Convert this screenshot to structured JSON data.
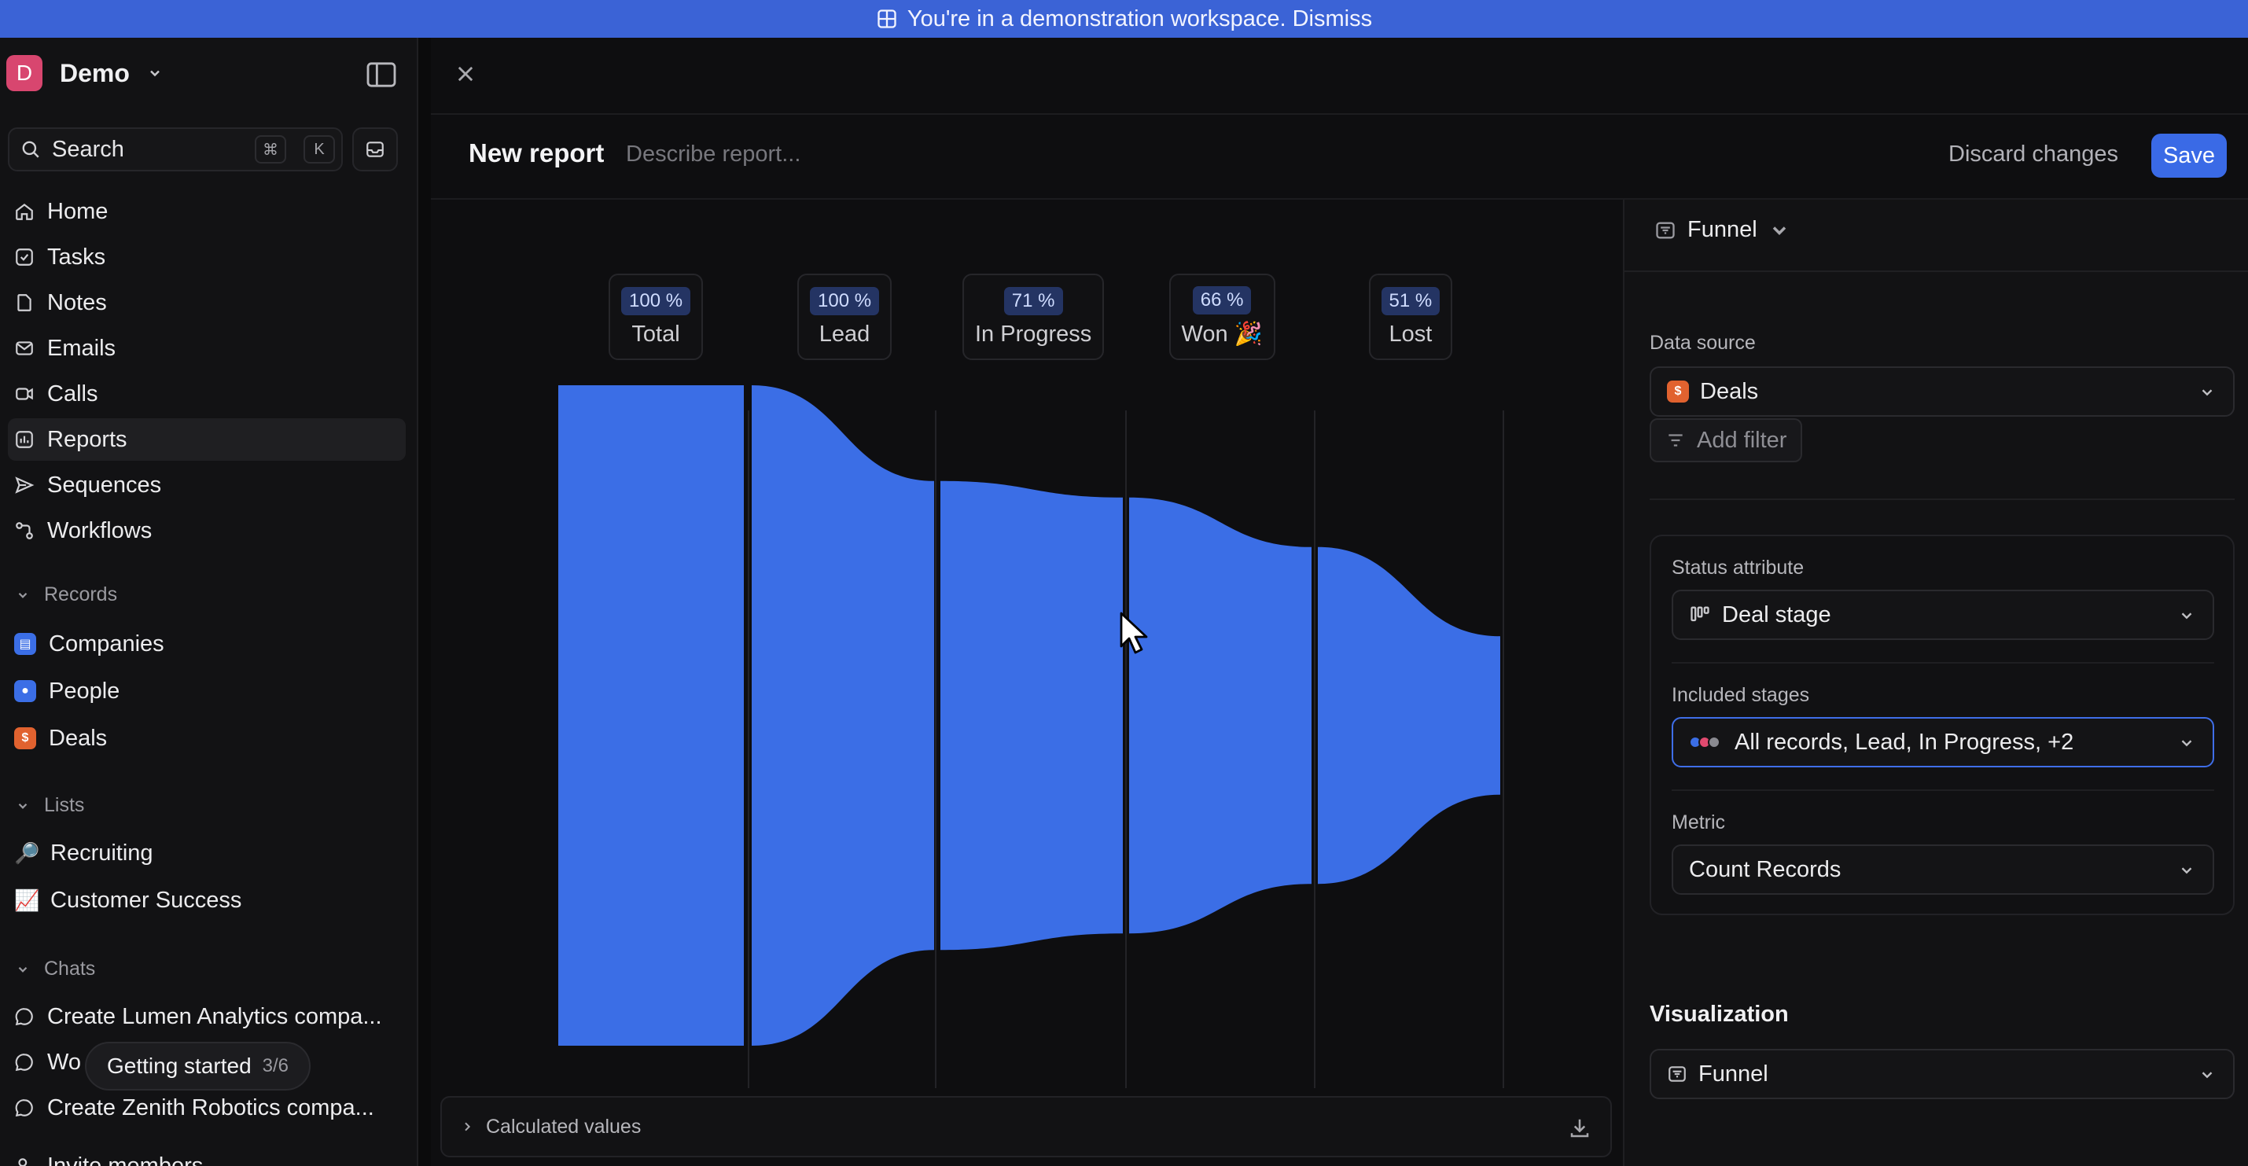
{
  "banner": {
    "text": "You're in a demonstration workspace. Dismiss"
  },
  "workspace": {
    "initial": "D",
    "name": "Demo"
  },
  "search": {
    "label": "Search",
    "key1": "⌘",
    "key2": "K"
  },
  "nav": [
    {
      "label": "Home",
      "icon": "home-icon"
    },
    {
      "label": "Tasks",
      "icon": "tasks-icon"
    },
    {
      "label": "Notes",
      "icon": "notes-icon"
    },
    {
      "label": "Emails",
      "icon": "emails-icon"
    },
    {
      "label": "Calls",
      "icon": "calls-icon"
    },
    {
      "label": "Reports",
      "icon": "reports-icon",
      "active": true
    },
    {
      "label": "Sequences",
      "icon": "sequences-icon"
    },
    {
      "label": "Workflows",
      "icon": "workflows-icon"
    }
  ],
  "records": {
    "header": "Records",
    "items": [
      {
        "label": "Companies",
        "color": "#3b6ee6",
        "glyph": "▤"
      },
      {
        "label": "People",
        "color": "#3b6ee6",
        "glyph": "●"
      },
      {
        "label": "Deals",
        "color": "#e1622f",
        "glyph": "$"
      }
    ]
  },
  "lists": {
    "header": "Lists",
    "items": [
      {
        "label": "Recruiting",
        "emoji": "🔎"
      },
      {
        "label": "Customer Success",
        "emoji": "📈"
      }
    ]
  },
  "chats": {
    "header": "Chats",
    "items": [
      {
        "label": "Create Lumen Analytics compa..."
      },
      {
        "label": "Wo                    ropo..."
      },
      {
        "label": "Create Zenith Robotics compa..."
      }
    ]
  },
  "tooltip": {
    "label": "Getting started",
    "count": "3/6"
  },
  "invite": {
    "label": "Invite members"
  },
  "report": {
    "title": "New report",
    "description_placeholder": "Describe report...",
    "discard": "Discard changes",
    "save": "Save"
  },
  "chart_data": {
    "type": "funnel",
    "color": "#3b6ee6",
    "stages": [
      {
        "name": "Total",
        "percent_label": "100 %",
        "value": 100
      },
      {
        "name": "Lead",
        "percent_label": "100 %",
        "value": 100
      },
      {
        "name": "In Progress",
        "percent_label": "71 %",
        "value": 71
      },
      {
        "name": "Won 🎉",
        "percent_label": "66 %",
        "value": 66
      },
      {
        "name": "Lost",
        "percent_label": "51 %",
        "value": 51
      }
    ],
    "end_value": 24
  },
  "calculated": {
    "label": "Calculated values"
  },
  "panel": {
    "viz_type": "Funnel",
    "data_source_label": "Data source",
    "data_source_value": "Deals",
    "add_filter": "Add filter",
    "status_attr_label": "Status attribute",
    "status_attr_value": "Deal stage",
    "included_label": "Included stages",
    "included_value": "All records, Lead, In Progress, +2",
    "metric_label": "Metric",
    "metric_value": "Count Records",
    "visualization_title": "Visualization",
    "visualization_value": "Funnel"
  }
}
